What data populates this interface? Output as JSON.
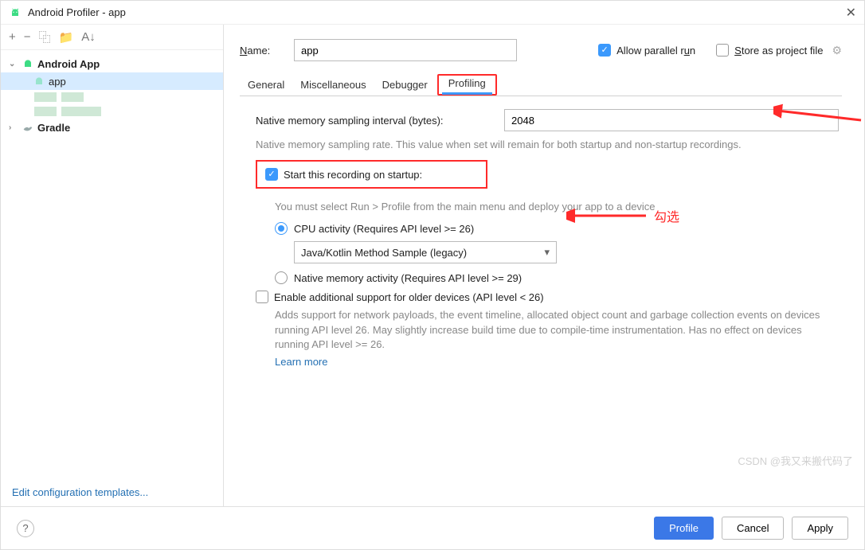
{
  "window": {
    "title": "Android Profiler - app"
  },
  "sidebar": {
    "toolbar": {
      "add": "+",
      "remove": "−",
      "copy": "⿻",
      "folder": "📁",
      "sort": "A↓"
    },
    "items": [
      {
        "label": "Android App",
        "level": 0,
        "expanded": true,
        "bold": true,
        "icon": "android"
      },
      {
        "label": "app",
        "level": 1,
        "selected": true,
        "icon": "android"
      },
      {
        "label": "",
        "level": 1,
        "icon": "blur"
      },
      {
        "label": "",
        "level": 1,
        "icon": "blur"
      },
      {
        "label": "Gradle",
        "level": 0,
        "expanded": false,
        "bold": true,
        "icon": "gradle"
      }
    ],
    "footer_link": "Edit configuration templates..."
  },
  "header": {
    "name_label": "Name:",
    "name_value": "app",
    "allow_parallel": "Allow parallel run",
    "store_as_project": "Store as project file"
  },
  "tabs": [
    "General",
    "Miscellaneous",
    "Debugger",
    "Profiling"
  ],
  "active_tab": "Profiling",
  "profiling": {
    "sampling_label": "Native memory sampling interval (bytes):",
    "sampling_value": "2048",
    "sampling_help": "Native memory sampling rate. This value when set will remain for both startup and non-startup recordings.",
    "start_on_startup": "Start this recording on startup:",
    "start_help": "You must select Run > Profile from the main menu and deploy your app to a device",
    "radio_cpu": "CPU activity (Requires API level >= 26)",
    "select_value": "Java/Kotlin Method Sample (legacy)",
    "radio_native": "Native memory activity (Requires API level >= 29)",
    "older_devices": "Enable additional support for older devices (API level < 26)",
    "older_help": "Adds support for network payloads, the event timeline, allocated object count and garbage collection events on devices running API level 26. May slightly increase build time due to compile-time instrumentation. Has no effect on devices running API level >= 26.",
    "learn_more": "Learn more"
  },
  "annotation": {
    "check_text": "勾选"
  },
  "footer": {
    "profile": "Profile",
    "cancel": "Cancel",
    "apply": "Apply"
  },
  "watermark": "CSDN @我又来搬代码了"
}
